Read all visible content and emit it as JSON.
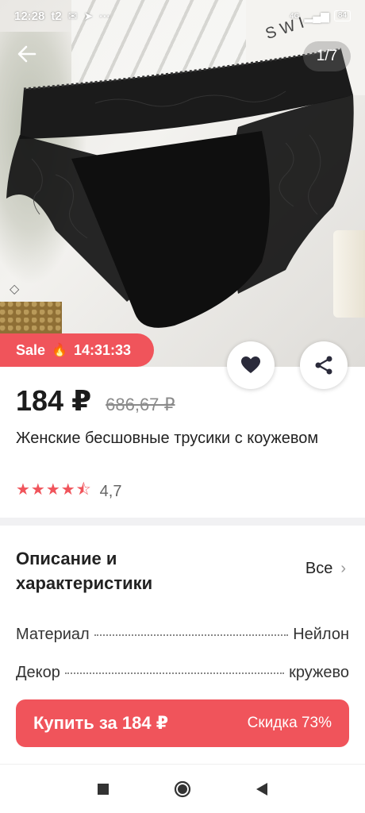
{
  "status_bar": {
    "time": "12:28",
    "carrier": "t2",
    "network": "4G",
    "battery": "84"
  },
  "gallery": {
    "counter": "1/7",
    "box_text": "SWI"
  },
  "sale": {
    "label": "Sale",
    "timer": "14:31:33"
  },
  "product": {
    "price": "184 ₽",
    "old_price": "686,67 ₽",
    "title": "Женские бесшовные трусики с коужевом",
    "rating": 4.7,
    "rating_label": "4,7"
  },
  "description": {
    "title": "Описание и характеристики",
    "see_all": "Все",
    "specs": [
      {
        "name": "Материал",
        "value": "Нейлон"
      },
      {
        "name": "Декор",
        "value": "кружево"
      }
    ]
  },
  "buy": {
    "label": "Купить за 184 ₽",
    "discount": "Скидка 73%"
  },
  "icons": {
    "back": "arrow-left-icon",
    "favorite": "heart-icon",
    "share": "share-icon",
    "sale": "flame-icon",
    "star": "star-icon",
    "chevron": "chevron-right-icon",
    "nav_recent": "square-icon",
    "nav_home": "circle-icon",
    "nav_back": "triangle-left-icon"
  },
  "colors": {
    "accent": "#f0545b",
    "text": "#222222",
    "muted": "#8a8a8a"
  }
}
